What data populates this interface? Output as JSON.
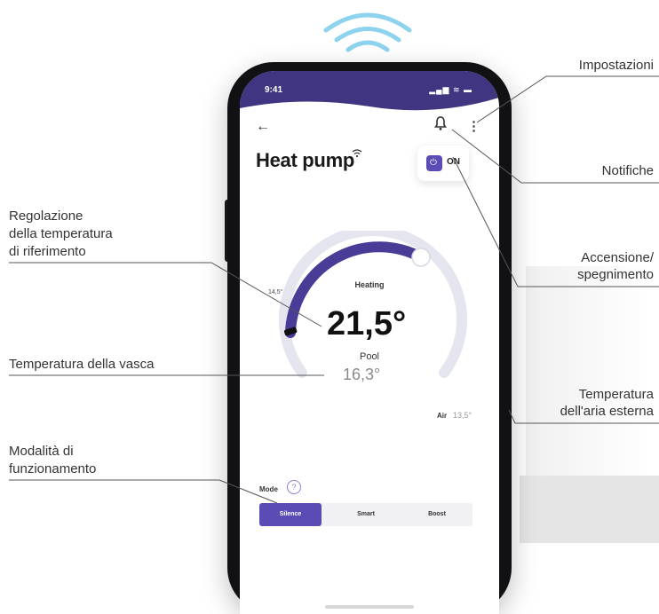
{
  "phone": {
    "status_time": "9:41",
    "status_icons": "▂▄▆ ≋ ▬",
    "back_icon": "←",
    "kebab_icon": "⋮",
    "title": "Heat pump",
    "power_state": "ON",
    "dial": {
      "mode_label": "Heating",
      "setpoint": "21,5°",
      "min_label": "14,5°",
      "pool_label": "Pool",
      "pool_temp": "16,3°"
    },
    "air": {
      "label": "Air",
      "value": "13,5°"
    },
    "mode": {
      "label": "Mode",
      "help_icon": "?",
      "options": [
        "Silence",
        "Smart",
        "Boost"
      ],
      "selected": "Silence"
    },
    "colors": {
      "accent": "#5b4bb5",
      "header": "#3f3580",
      "track": "#e4e5ee"
    }
  },
  "callouts": {
    "impostazioni": "Impostazioni",
    "notifiche": "Notifiche",
    "accensione_1": "Accensione/",
    "accensione_2": "spegnimento",
    "temp_esterna_1": "Temperatura",
    "temp_esterna_2": "dell'aria esterna",
    "regolazione_1": "Regolazione",
    "regolazione_2": "della temperatura",
    "regolazione_3": "di riferimento",
    "temp_vasca": "Temperatura della vasca",
    "modalita_1": "Modalità di",
    "modalita_2": "funzionamento"
  },
  "icons": {
    "wifi": "wifi-icon",
    "bell": "bell-icon",
    "power": "power-icon"
  }
}
